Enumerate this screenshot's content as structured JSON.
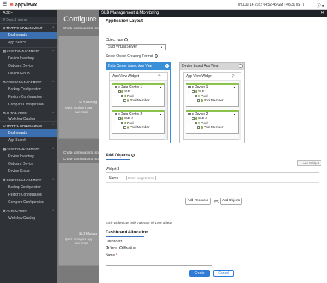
{
  "topbar": {
    "logo_text": "appviewx",
    "timestamp": "Thu Jul 14 2022 04:52:45 GMT+0530 (IST)"
  },
  "sidebar": {
    "title": "ADC+",
    "search_placeholder": "Search menu",
    "groups_top": [
      {
        "section": "TRAFFIC MANAGEMENT",
        "items": [
          "Dashboards",
          "App Search"
        ],
        "selected": 0
      },
      {
        "section": "ASSET MANAGEMENT",
        "items": [
          "Device Inventory",
          "Onboard Device",
          "Device Group"
        ]
      },
      {
        "section": "CONFIG MANAGEMENT",
        "items": [
          "Backup Configuration",
          "Restore Configuration",
          "Compare Configuration"
        ]
      },
      {
        "section": "AUTOMATION",
        "items": [
          "Workflow Catalog"
        ]
      }
    ],
    "groups_bottom": [
      {
        "section": "TRAFFIC MANAGEMENT",
        "items": [
          "Dashboards",
          "App Search"
        ],
        "selected": 0
      },
      {
        "section": "ASSET MANAGEMENT",
        "items": [
          "Device Inventory",
          "Onboard Device",
          "Device Group"
        ]
      },
      {
        "section": "CONFIG MANAGEMENT",
        "items": [
          "Backup Configuration",
          "Restore Configuration",
          "Compare Configuration"
        ]
      },
      {
        "section": "AUTOMATION",
        "items": [
          "Workflow Catalog"
        ]
      }
    ]
  },
  "background": {
    "title": "Configure Da",
    "subtitle": "Create dashboards to mo",
    "card_title": "SLB Manag",
    "card_desc_1": "Quick configure App",
    "card_desc_2": "and monit",
    "title2": "Create dashboards to mo",
    "subtitle2": "Create dashboards to mo",
    "card2_title": "SLB Manag",
    "card2_desc_1": "Quick configure App",
    "card2_desc_2": "and monit"
  },
  "modal": {
    "title": "SLB Management & Monitoring",
    "app_layout": {
      "heading": "Application Layout",
      "object_type_label": "Object type",
      "object_type_value": "SLB Virtual Server",
      "grouping_label": "Select Object Grouping Format"
    },
    "panel_dc": {
      "title": "Data Center based App View",
      "widget_title": "App View Widget",
      "groups": [
        {
          "name": "Data Center 1",
          "slb": "SLB 1",
          "pool": "Pool",
          "member": "Pool Member"
        },
        {
          "name": "Data Center 2",
          "slb": "SLB 2",
          "pool": "Pool",
          "member": "Pool Member"
        }
      ]
    },
    "panel_device": {
      "title": "Device based App View",
      "widget_title": "App View Widget",
      "groups": [
        {
          "name": "Device 1",
          "slb": "SLB 1",
          "pool": "Pool",
          "member": "Pool Member"
        },
        {
          "name": "Device 2",
          "slb": "SLB 2",
          "pool": "Pool",
          "member": "Pool Member"
        }
      ]
    },
    "add_objects": {
      "heading": "Add Objects",
      "add_widget_label": "+ Add Widget",
      "widget_label": "Widget 1",
      "name_label": "Name",
      "name_placeholder": "Enter widget name",
      "add_resource_label": "Add Resource",
      "or_label": "(or)",
      "add_objects_label": "Add Objects",
      "note": "Each widget can hold maximum of 1000 objects"
    },
    "allocation": {
      "heading": "Dashboard Allocation",
      "dashboard_label": "Dashboard",
      "new_label": "New",
      "existing_label": "Existing",
      "name_label": "Name"
    },
    "actions": {
      "create": "Create",
      "cancel": "Cancel"
    }
  }
}
